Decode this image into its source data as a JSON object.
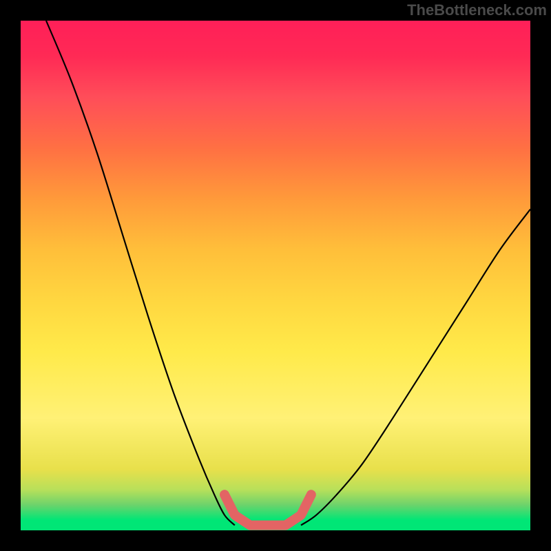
{
  "watermark": "TheBottleneck.com",
  "chart_data": {
    "type": "line",
    "title": "",
    "xlabel": "",
    "ylabel": "",
    "xlim": [
      0,
      100
    ],
    "ylim": [
      0,
      100
    ],
    "series": [
      {
        "name": "left-curve",
        "x": [
          5,
          10,
          15,
          20,
          25,
          30,
          35,
          38,
          40,
          42
        ],
        "y": [
          100,
          88,
          74,
          58,
          42,
          27,
          14,
          7,
          3,
          1
        ]
      },
      {
        "name": "right-curve",
        "x": [
          55,
          58,
          62,
          67,
          73,
          80,
          87,
          94,
          100
        ],
        "y": [
          1,
          3,
          7,
          13,
          22,
          33,
          44,
          55,
          63
        ]
      },
      {
        "name": "marker-band",
        "x": [
          40,
          42,
          45,
          48,
          52,
          55,
          57
        ],
        "y": [
          7,
          3,
          1,
          1,
          1,
          3,
          7
        ]
      }
    ],
    "annotations": []
  }
}
